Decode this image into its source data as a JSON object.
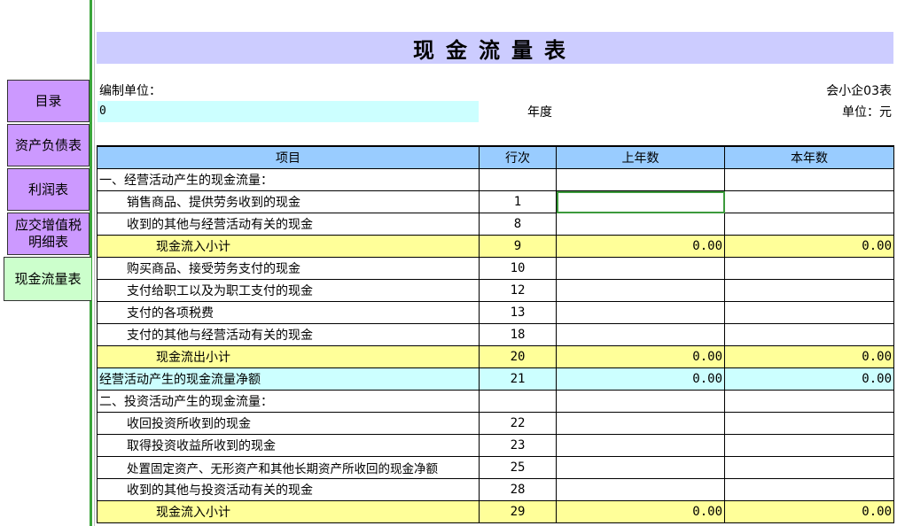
{
  "tabs": [
    {
      "label": "目录",
      "active": false
    },
    {
      "label": "资产负债表",
      "active": false
    },
    {
      "label": "利润表",
      "active": false
    },
    {
      "label": "应交增值税明细表",
      "active": false
    },
    {
      "label": "现金流量表",
      "active": true
    }
  ],
  "report": {
    "title": "现金流量表",
    "unit_label": "编制单位：",
    "unit_value": "0",
    "year_label": "年度",
    "form_code": "会小企03表",
    "currency_label": "单位：元",
    "headers": {
      "item": "项目",
      "line": "行次",
      "prev": "上年数",
      "curr": "本年数"
    },
    "rows": [
      {
        "item": "一、经营活动产生的现金流量：",
        "line": "",
        "prev": "",
        "curr": ""
      },
      {
        "item": "销售商品、提供劳务收到的现金",
        "line": "1",
        "prev": "",
        "curr": ""
      },
      {
        "item": "收到的其他与经营活动有关的现金",
        "line": "8",
        "prev": "",
        "curr": ""
      },
      {
        "item": "现金流入小计",
        "line": "9",
        "prev": "0.00",
        "curr": "0.00"
      },
      {
        "item": "购买商品、接受劳务支付的现金",
        "line": "10",
        "prev": "",
        "curr": ""
      },
      {
        "item": "支付给职工以及为职工支付的现金",
        "line": "12",
        "prev": "",
        "curr": ""
      },
      {
        "item": "支付的各项税费",
        "line": "13",
        "prev": "",
        "curr": ""
      },
      {
        "item": "支付的其他与经营活动有关的现金",
        "line": "18",
        "prev": "",
        "curr": ""
      },
      {
        "item": "现金流出小计",
        "line": "20",
        "prev": "0.00",
        "curr": "0.00"
      },
      {
        "item": "经营活动产生的现金流量净额",
        "line": "21",
        "prev": "0.00",
        "curr": "0.00"
      },
      {
        "item": "二、投资活动产生的现金流量：",
        "line": "",
        "prev": "",
        "curr": ""
      },
      {
        "item": "收回投资所收到的现金",
        "line": "22",
        "prev": "",
        "curr": ""
      },
      {
        "item": "取得投资收益所收到的现金",
        "line": "23",
        "prev": "",
        "curr": ""
      },
      {
        "item": "处置固定资产、无形资产和其他长期资产所收回的现金净额",
        "line": "25",
        "prev": "",
        "curr": ""
      },
      {
        "item": "收到的其他与投资活动有关的现金",
        "line": "28",
        "prev": "",
        "curr": ""
      },
      {
        "item": "现金流入小计",
        "line": "29",
        "prev": "0.00",
        "curr": "0.00"
      }
    ]
  },
  "colors": {
    "tab_bg": "#cc99ff",
    "active_tab_bg": "#ccffcc",
    "title_bg": "#ccccff",
    "header_bg": "#99ccff",
    "subtotal_bg": "#ffff99",
    "net_bg": "#ccffff",
    "selection": "#3c9a3c"
  }
}
